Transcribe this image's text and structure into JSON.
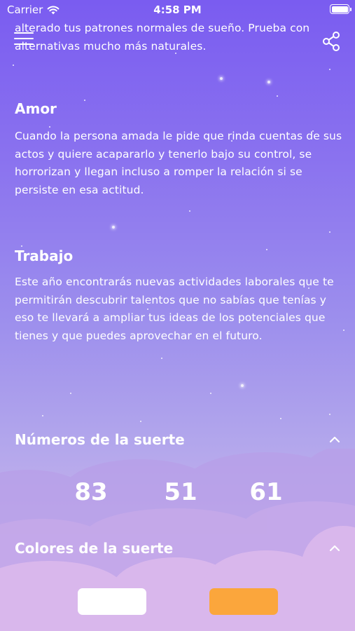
{
  "status_bar": {
    "carrier": "Carrier",
    "time": "4:58 PM",
    "battery_level": 1.0
  },
  "top_paragraph": "alterado tus patrones normales de sueño. Prueba con alternativas mucho más naturales.",
  "sections": [
    {
      "title": "Amor",
      "text": "Cuando la persona amada le pide que rinda cuentas de sus actos y quiere acapararlo y tenerlo bajo su control, se horrorizan y llegan incluso a romper la relación si se persiste en esa actitud."
    },
    {
      "title": "Trabajo",
      "text": "Este año encontrarás nuevas actividades laborales que te permitirán descubrir talentos que no sabías que tenías y eso te llevará a ampliar tus ideas de los potenciales que tienes y que puedes aprovechar en el futuro."
    }
  ],
  "lucky_numbers": {
    "title": "Números de la suerte",
    "values": [
      "83",
      "51",
      "61"
    ]
  },
  "lucky_colors": {
    "title": "Colores de la suerte",
    "colors": [
      "#ffffff",
      "#fba63c"
    ]
  },
  "icons": {
    "menu": "hamburger-menu-icon",
    "share": "share-icon",
    "collapse": "chevron-up-icon",
    "wifi": "wifi-icon",
    "battery": "battery-icon"
  },
  "theme": {
    "background_top": "#7a5cf0",
    "background_bottom": "#d7b6ea",
    "text": "#ffffff"
  }
}
